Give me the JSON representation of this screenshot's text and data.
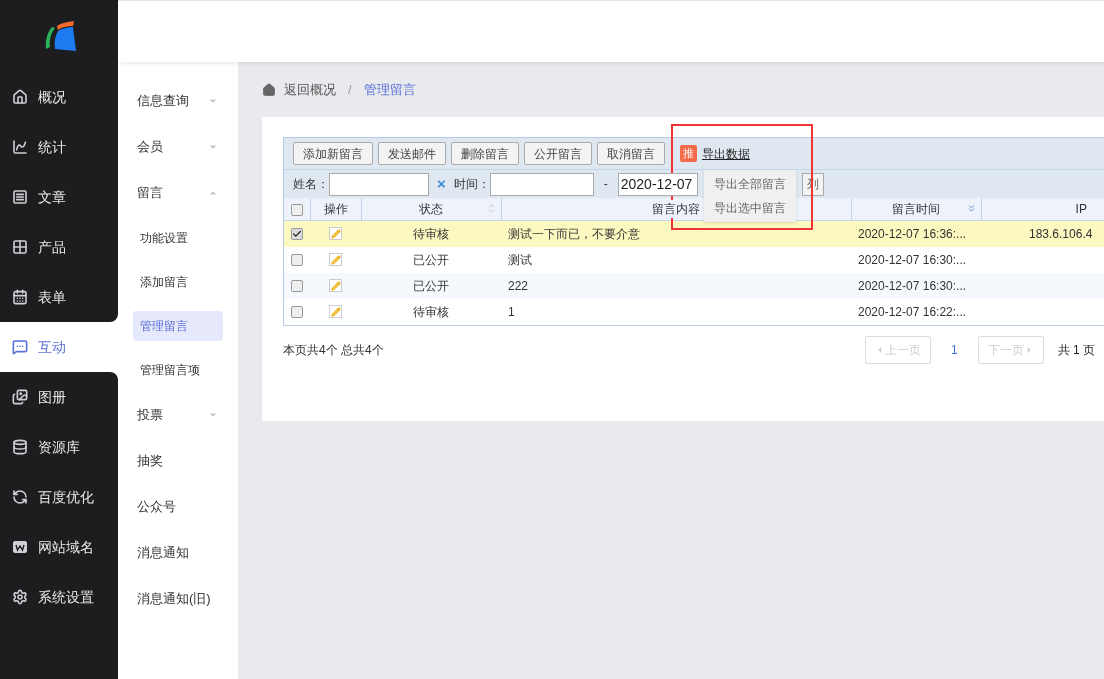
{
  "nav": [
    {
      "label": "概况",
      "selected": false
    },
    {
      "label": "统计",
      "selected": false
    },
    {
      "label": "文章",
      "selected": false
    },
    {
      "label": "产品",
      "selected": false
    },
    {
      "label": "表单",
      "selected": false
    },
    {
      "label": "互动",
      "selected": true
    },
    {
      "label": "图册",
      "selected": false
    },
    {
      "label": "资源库",
      "selected": false
    },
    {
      "label": "百度优化",
      "selected": false
    },
    {
      "label": "网站域名",
      "selected": false
    },
    {
      "label": "系统设置",
      "selected": false
    }
  ],
  "subnav": [
    {
      "label": "信息查询",
      "kind": "group",
      "expanded": false
    },
    {
      "label": "会员",
      "kind": "group",
      "expanded": false
    },
    {
      "label": "留言",
      "kind": "group",
      "expanded": true,
      "children": [
        {
          "label": "功能设置",
          "selected": false
        },
        {
          "label": "添加留言",
          "selected": false
        },
        {
          "label": "管理留言",
          "selected": true
        },
        {
          "label": "管理留言项",
          "selected": false
        }
      ]
    },
    {
      "label": "投票",
      "kind": "group",
      "expanded": false
    },
    {
      "label": "抽奖",
      "kind": "link"
    },
    {
      "label": "公众号",
      "kind": "link"
    },
    {
      "label": "消息通知",
      "kind": "link"
    },
    {
      "label": "消息通知(旧)",
      "kind": "link"
    }
  ],
  "breadcrumb": {
    "back": "返回概况",
    "separator": "/",
    "current": "管理留言"
  },
  "toolbar": {
    "buttons": [
      "添加新留言",
      "发送邮件",
      "删除留言",
      "公开留言",
      "取消留言"
    ],
    "badge": "推",
    "export": "导出数据",
    "export_menu": [
      "导出全部留言",
      "导出选中留言"
    ]
  },
  "filter": {
    "name_label": "姓名：",
    "clear": "×",
    "time_label": "时间：",
    "dash": "-",
    "date_to": "2020-12-07",
    "button": "列"
  },
  "table": {
    "all_checked": false,
    "columns": [
      {
        "label": "操作"
      },
      {
        "label": "状态"
      },
      {
        "label": "留言内容"
      },
      {
        "label": "留言时间"
      },
      {
        "label": "IP"
      }
    ],
    "rows": [
      {
        "selected": true,
        "status": "待审核",
        "content": "测试一下而已，不要介意",
        "time": "2020-12-07 16:36:...",
        "ip": "183.6.106.4"
      },
      {
        "selected": false,
        "status": "已公开",
        "content": "测试",
        "time": "2020-12-07 16:30:...",
        "ip": ""
      },
      {
        "selected": false,
        "status": "已公开",
        "content": "222",
        "time": "2020-12-07 16:30:...",
        "ip": ""
      },
      {
        "selected": false,
        "status": "待审核",
        "content": "1",
        "time": "2020-12-07 16:22:...",
        "ip": ""
      }
    ]
  },
  "summary": "本页共4个 总共4个",
  "pagination": {
    "prev": "上一页",
    "page": "1",
    "next": "下一页",
    "total": "共 1 页"
  }
}
